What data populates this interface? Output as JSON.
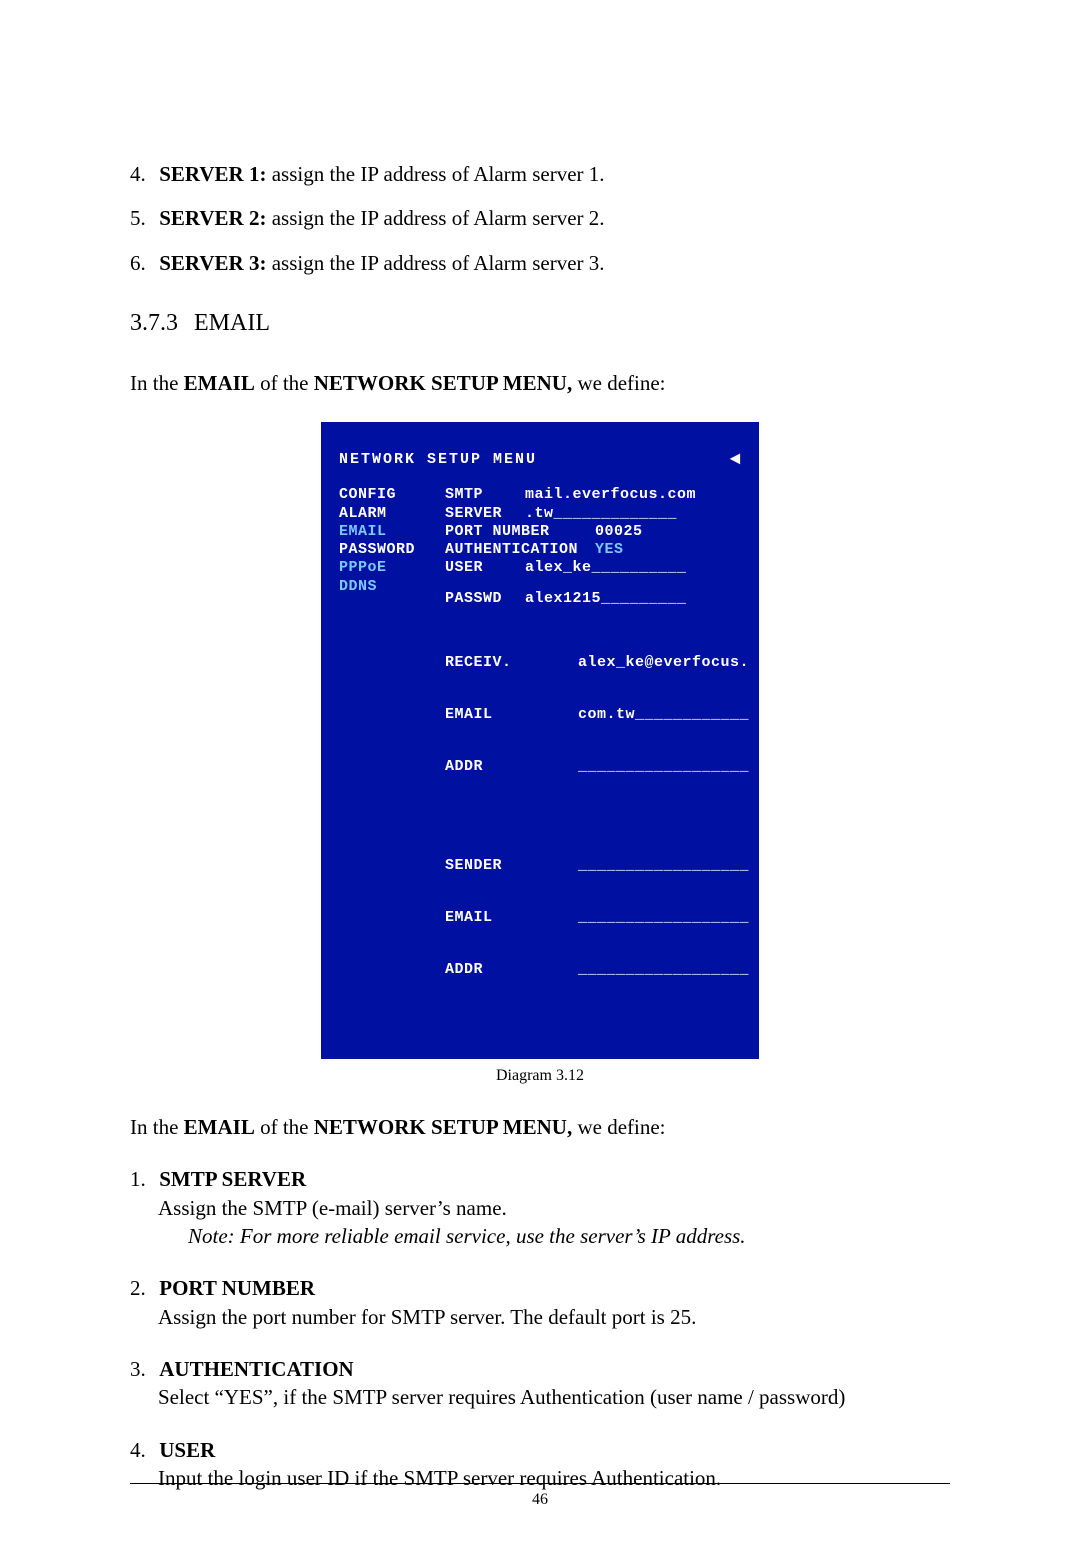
{
  "server_items": [
    {
      "num": "4.",
      "label": "SERVER 1:",
      "desc": " assign the IP address of Alarm server 1."
    },
    {
      "num": "5.",
      "label": "SERVER 2:",
      "desc": " assign the IP address of Alarm server 2."
    },
    {
      "num": "6.",
      "label": "SERVER 3:",
      "desc": " assign the IP address of Alarm server 3."
    }
  ],
  "section": {
    "num": "3.7.3",
    "title": "EMAIL"
  },
  "intro1": {
    "prefix": "In the ",
    "email": "EMAIL",
    "mid": " of the ",
    "menu": "NETWORK SETUP MENU,",
    "suffix": " we define:"
  },
  "osd": {
    "title": "NETWORK SETUP MENU",
    "arrow": "◄",
    "menu": [
      "CONFIG",
      "ALARM",
      "EMAIL",
      "PASSWORD",
      "PPPoE",
      "DDNS"
    ],
    "selected_index": 2,
    "smtp": {
      "label1": "SMTP",
      "label2": "SERVER",
      "value1": "mail.everfocus.com",
      "value2": ".tw_____________"
    },
    "port": {
      "label": "PORT NUMBER",
      "value": "00025"
    },
    "auth": {
      "label": "AUTHENTICATION",
      "value": "YES"
    },
    "user": {
      "label": "USER",
      "value": "alex_ke__________"
    },
    "passwd": {
      "label": "PASSWD",
      "value": "alex1215_________"
    },
    "receiv": {
      "label1": "RECEIV.",
      "label2": "EMAIL",
      "label3": "ADDR",
      "value1": "alex_ke@everfocus.",
      "value2": "com.tw____________",
      "value3": "__________________"
    },
    "sender": {
      "label1": "SENDER",
      "label2": "EMAIL",
      "label3": "ADDR",
      "value1": "__________________",
      "value2": "__________________",
      "value3": "__________________"
    }
  },
  "diagram_caption": "Diagram 3.12",
  "intro2": {
    "prefix": "In the ",
    "email": "EMAIL",
    "mid": " of the ",
    "menu": "NETWORK SETUP MENU,",
    "suffix": " we define:"
  },
  "defs": [
    {
      "num": "1.",
      "title": "SMTP SERVER",
      "desc": "Assign the SMTP (e-mail) server’s name.",
      "note": "Note: For more reliable email service, use the server’s IP address."
    },
    {
      "num": "2.",
      "title": "PORT NUMBER",
      "desc": "Assign the port number for SMTP server. The default port is 25."
    },
    {
      "num": "3.",
      "title": "AUTHENTICATION",
      "desc": "Select “YES”, if the SMTP server requires Authentication (user name / password)"
    },
    {
      "num": "4.",
      "title": "USER",
      "desc": "Input the login user ID if the SMTP server requires Authentication."
    }
  ],
  "page_number": "46"
}
